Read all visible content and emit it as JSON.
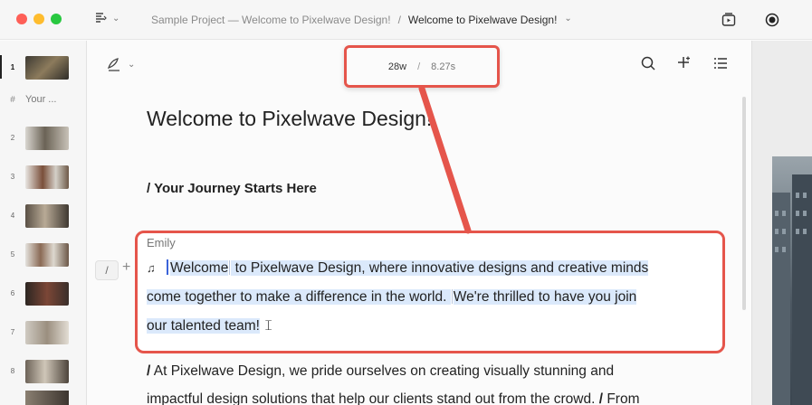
{
  "window": {
    "breadcrumb_project": "Sample Project — Welcome to Pixelwave Design!",
    "breadcrumb_separator": "/",
    "breadcrumb_current": "Welcome to Pixelwave Design!"
  },
  "sidebar": {
    "scenes": [
      {
        "num": "1",
        "type": "image",
        "active": true
      },
      {
        "num": "#",
        "type": "text",
        "label": "Your ..."
      },
      {
        "num": "2",
        "type": "image"
      },
      {
        "num": "3",
        "type": "image"
      },
      {
        "num": "4",
        "type": "image"
      },
      {
        "num": "5",
        "type": "image"
      },
      {
        "num": "6",
        "type": "image"
      },
      {
        "num": "7",
        "type": "image"
      },
      {
        "num": "8",
        "type": "image"
      }
    ]
  },
  "editor": {
    "stats": {
      "words": "28w",
      "separator": "/",
      "duration": "8.27s"
    },
    "title": "Welcome to Pixelwave Design!",
    "section_heading": "/ Your Journey Starts Here",
    "slash_button": "/",
    "plus_button": "+",
    "paragraph": {
      "speaker": "Emily",
      "line1a": "Welcome",
      "line1b": " to Pixelwave Design, where innovative designs and creative minds",
      "line2a": "come together to make a difference in the world. ",
      "line2b": "We're thrilled to have you join",
      "line3": "our talented team!"
    },
    "body_line1": "At Pixelwave Design, we pride ourselves on creating visually stunning and",
    "body_line2": "impactful design solutions that help our clients stand out from the crowd.",
    "body_line2_tail": "From",
    "slash_marker": "/"
  },
  "colors": {
    "accent_red": "#e5554b",
    "highlight": "#dbe9fb",
    "caret": "#3b64d9"
  }
}
